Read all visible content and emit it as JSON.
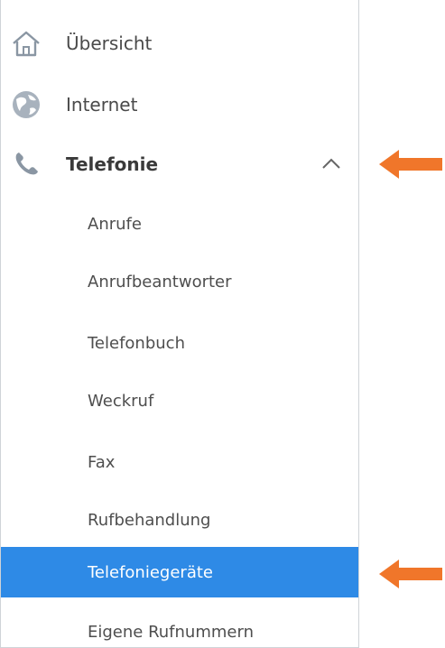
{
  "colors": {
    "accent": "#2e8ae6",
    "arrow": "#f0762a",
    "text": "#4a4a4a",
    "icon": "#8a96a3"
  },
  "menu": {
    "top_items": [
      {
        "label": "Übersicht",
        "icon": "home-icon"
      },
      {
        "label": "Internet",
        "icon": "globe-icon"
      },
      {
        "label": "Telefonie",
        "icon": "phone-icon",
        "expanded": true
      }
    ],
    "sub_items": [
      {
        "label": "Anrufe"
      },
      {
        "label": "Anrufbeantworter"
      },
      {
        "label": "Telefonbuch"
      },
      {
        "label": "Weckruf"
      },
      {
        "label": "Fax"
      },
      {
        "label": "Rufbehandlung"
      },
      {
        "label": "Telefoniegeräte",
        "active": true
      },
      {
        "label": "Eigene Rufnummern"
      }
    ]
  }
}
